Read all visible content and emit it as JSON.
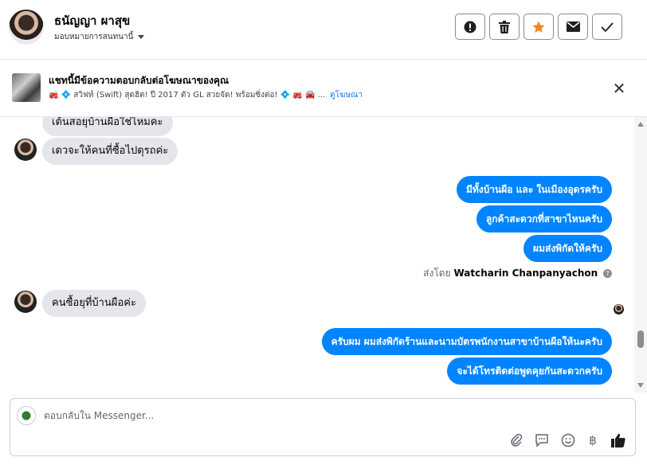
{
  "header": {
    "name": "ธนัญญา ผาสุข",
    "assign_label": "มอบหมายการสนทนานี้"
  },
  "ad": {
    "title": "แชทนี้มีข้อความตอบกลับต่อโฆษณาของคุณ",
    "subtitle": "🚒 💠 สวิฟท์ (Swift) สุดฮิต! ปี 2017 ตัว GL สวยจัด! พร้อมซิ่งต่อ! 💠 🚒 🚘 ...",
    "view_ad": "ดูโฆษณา"
  },
  "messages": [
    {
      "dir": "in",
      "text": "เต้นสอยุบ้านผือใช่ไหมคะ"
    },
    {
      "dir": "in",
      "text": "เดวจะให้คนที่ซื้อไปดุรถค่ะ"
    },
    {
      "dir": "out",
      "text": "มีทั้งบ้านผือ และ ในเมืองอุดรครับ"
    },
    {
      "dir": "out",
      "text": "ลูกค้าสะดวกที่สาขาไหนครับ"
    },
    {
      "dir": "out",
      "text": "ผมส่งพิกัดให้ครับ"
    },
    {
      "dir": "in",
      "text": "คนซื้อยุที่บ้านผือค่ะ"
    },
    {
      "dir": "out",
      "text": "ครับผม ผมส่งพิกัดร้านและนามบัตรพนักงานสาขาบ้านผือให้นะครับ"
    },
    {
      "dir": "out",
      "text": "จะได้โทรติดต่อพูดคุยกันสะดวกครับ"
    }
  ],
  "sent_by": {
    "prefix": "ส่งโดย",
    "name": "Watcharin Chanpanyachon"
  },
  "composer": {
    "placeholder": "ตอบกลับใน Messenger..."
  },
  "colors": {
    "outgoing_bubble": "#0084ff",
    "incoming_bubble": "#e4e6eb",
    "star": "#f5821f",
    "link": "#1877f2"
  }
}
